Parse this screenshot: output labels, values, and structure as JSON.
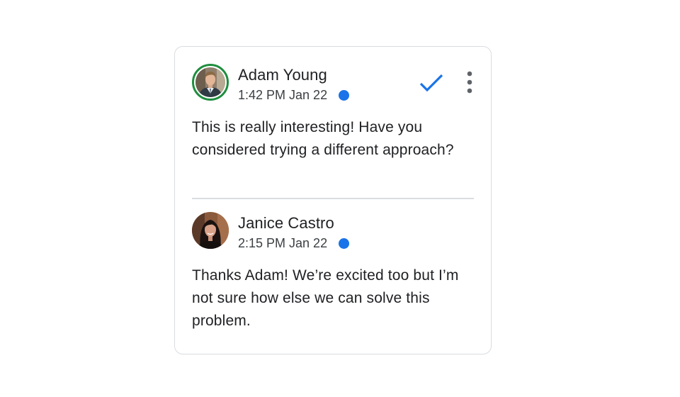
{
  "thread": {
    "comments": [
      {
        "author": "Adam Young",
        "time": "1:42 PM Jan 22",
        "text": "This is really interesting! Have you considered trying a different approach?",
        "avatar": "adam-avatar",
        "avatar_ring_color": "#1e8e3e",
        "unread": true
      },
      {
        "author": "Janice Castro",
        "time": "2:15 PM Jan 22",
        "text": "Thanks Adam! We’re excited too but I’m not sure how else we can solve this problem.",
        "avatar": "janice-avatar",
        "unread": true
      }
    ],
    "actions": {
      "resolve_icon": "checkmark-icon",
      "more_icon": "more-vert-icon"
    }
  },
  "colors": {
    "accent": "#1a73e8",
    "avatar_ring": "#1e8e3e",
    "divider": "#dadce0",
    "text_primary": "#202124",
    "text_secondary": "#3c4043"
  }
}
